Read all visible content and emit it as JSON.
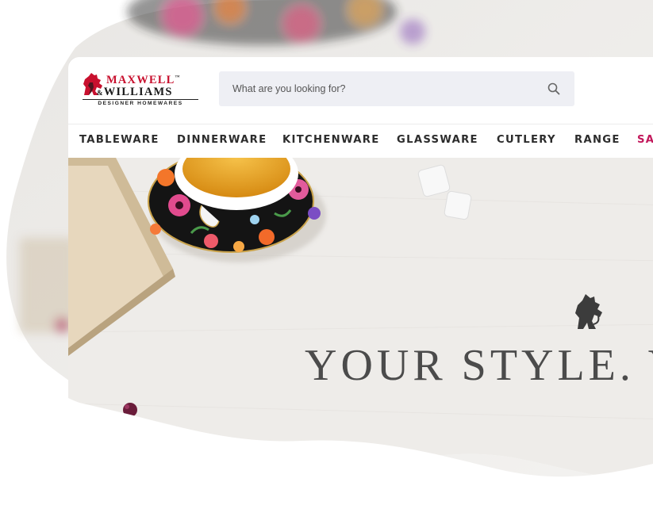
{
  "brand": {
    "name_line1": "MAXWELL",
    "trademark": "™",
    "name_amp": "&",
    "name_line2": "WILLIAMS",
    "tagline": "DESIGNER HOMEWARES"
  },
  "search": {
    "placeholder": "What are you looking for?",
    "icon": "search-icon"
  },
  "nav": {
    "items": [
      {
        "label": "TABLEWARE"
      },
      {
        "label": "DINNERWARE"
      },
      {
        "label": "KITCHENWARE"
      },
      {
        "label": "GLASSWARE"
      },
      {
        "label": "CUTLERY"
      },
      {
        "label": "RANGE"
      },
      {
        "label": "SA",
        "color": "#c2185b"
      }
    ]
  },
  "hero": {
    "headline": "YOUR STYLE. Y",
    "emblem": "lion-emblem-icon"
  },
  "colors": {
    "brand_red": "#c8102e",
    "sale_pink": "#c2185b",
    "search_bg": "#eeeff4",
    "hero_bg": "#eeece9",
    "headline": "#4b4b4b"
  }
}
